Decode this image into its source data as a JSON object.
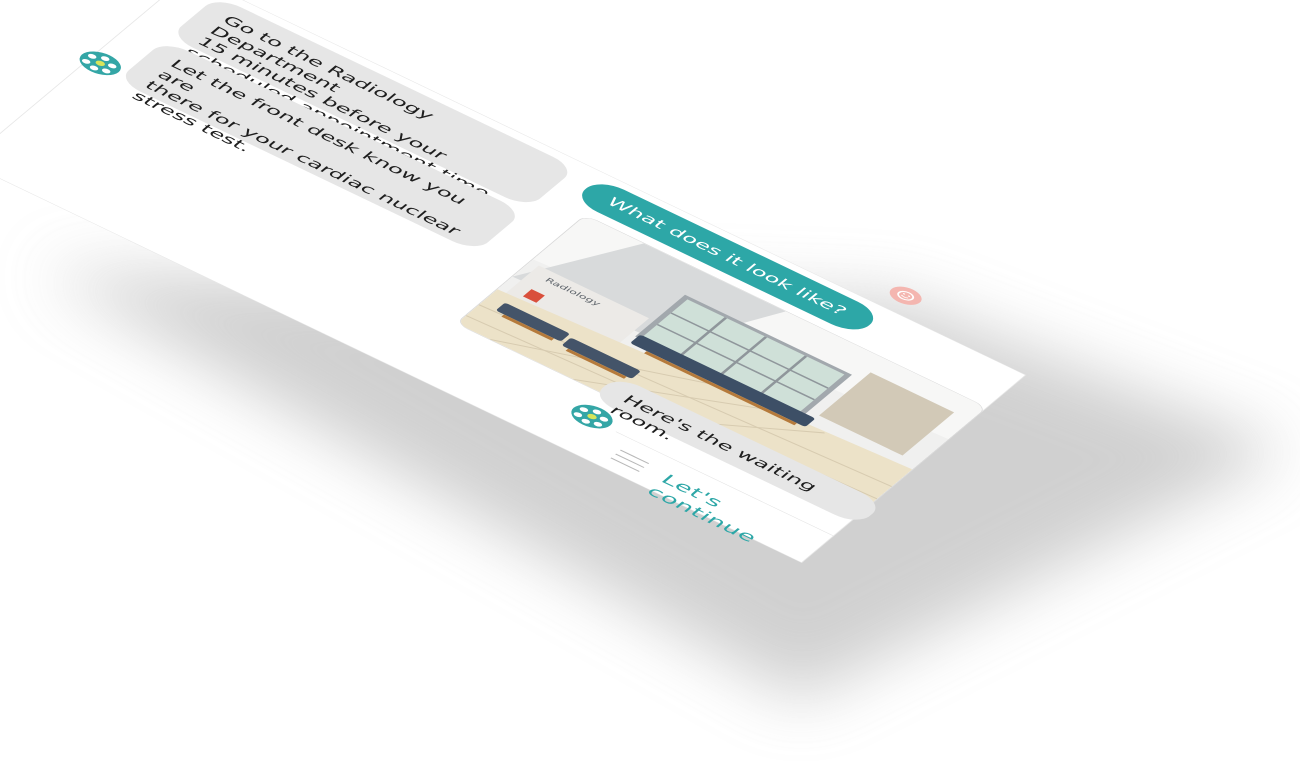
{
  "conversation": {
    "bot_message_1": "Go to the Radiology Department\n15 minutes before your\nscheduled appointment time.",
    "bot_message_2": "Let the front desk know you are\nthere for your cardiac nuclear\nstress test.",
    "user_message": "What does it look like?",
    "photo_sign": "Radiology",
    "bot_message_3": "Here's the waiting room."
  },
  "footer": {
    "continue_label": "Let's continue",
    "menu_icon": "hamburger-menu-icon"
  },
  "icons": {
    "bot_avatar": "bot-avatar-icon",
    "user_avatar": "user-avatar-icon"
  },
  "colors": {
    "accent": "#2da7a7",
    "bot_bubble": "#e6e6e6",
    "user_avatar": "#f4b6b0",
    "avatar_center": "#d7e55a"
  }
}
